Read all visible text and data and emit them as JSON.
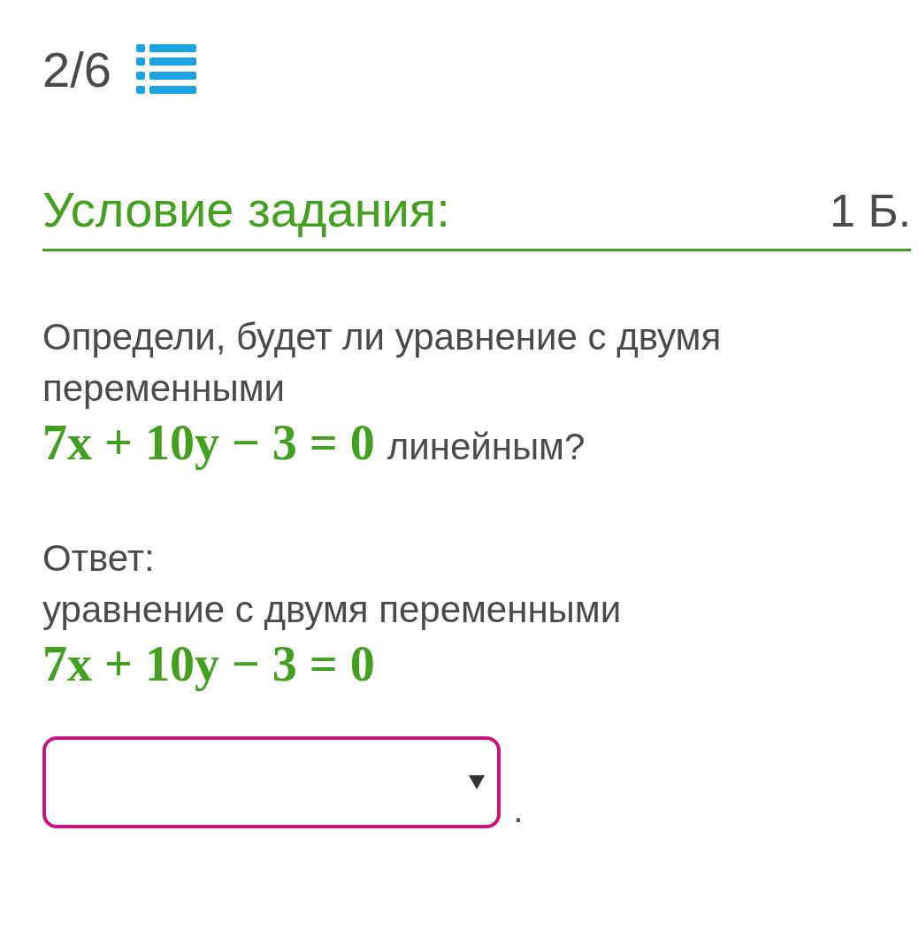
{
  "counter": {
    "text": "2/6"
  },
  "task": {
    "title": "Условие задания:",
    "points": "1 Б."
  },
  "question": {
    "text": "Определи, будет ли уравнение с двумя переменными",
    "equation": "7x + 10y − 3 = 0",
    "suffix": "линейным?"
  },
  "answer": {
    "label": "Ответ:",
    "text": "уравнение с двумя переменными",
    "equation": "7x + 10y − 3 = 0",
    "field": {
      "kind": "dropdown"
    },
    "suffix": "."
  }
}
